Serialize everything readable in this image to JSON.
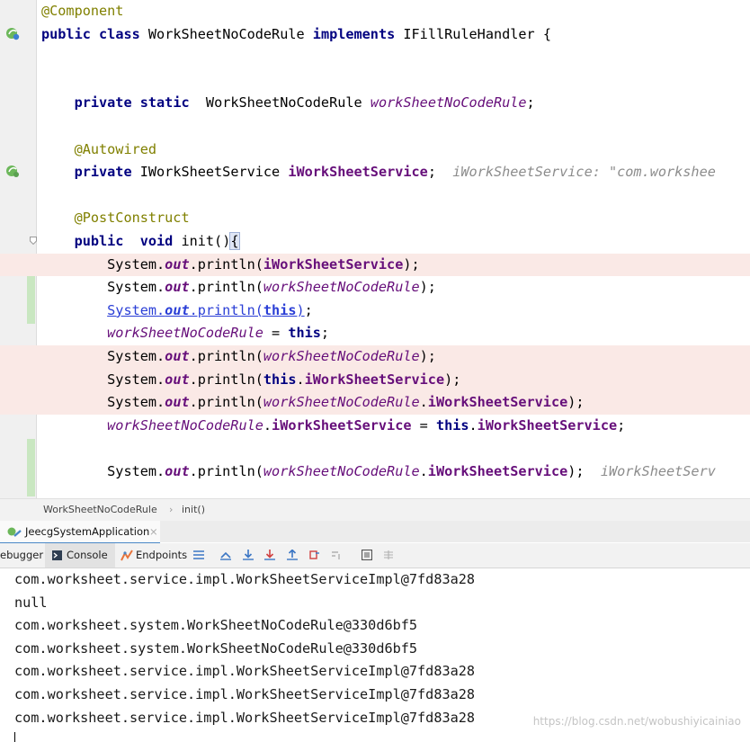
{
  "editor": {
    "lines": {
      "l0": {
        "ann": "@Component"
      },
      "l1": {
        "kw1": "public",
        "kw2": "class",
        "name": "WorkSheetNoCodeRule",
        "kw3": "implements",
        "iface": "IFillRuleHandler",
        "brace": "{"
      },
      "l4": {
        "kw1": "private",
        "kw2": "static",
        "type": "WorkSheetNoCodeRule",
        "field": "workSheetNoCodeRule",
        "semi": ";"
      },
      "l6": {
        "ann": "@Autowired"
      },
      "l7": {
        "kw1": "private",
        "type": "IWorkSheetService",
        "field": "iWorkSheetService",
        "semi": ";",
        "hint": "iWorkSheetService: \"com.workshee"
      },
      "l9": {
        "ann": "@PostConstruct"
      },
      "l10": {
        "kw1": "public",
        "kw2": "void",
        "method": "init()",
        "brace": "{"
      },
      "l11": {
        "sys": "System.",
        "out": "out",
        "call": ".println(",
        "arg": "iWorkSheetService",
        "end": ");"
      },
      "l12": {
        "sys": "System.",
        "out": "out",
        "call": ".println(",
        "arg": "workSheetNoCodeRule",
        "end": ");"
      },
      "l13": {
        "sys": "System.",
        "out": "out",
        "call": ".println(",
        "arg": "this",
        "close": ")",
        "end": ";"
      },
      "l14": {
        "field": "workSheetNoCodeRule",
        "eq": " = ",
        "kw": "this",
        "end": ";"
      },
      "l15": {
        "sys": "System.",
        "out": "out",
        "call": ".println(",
        "arg": "workSheetNoCodeRule",
        "end": ");"
      },
      "l16": {
        "sys": "System.",
        "out": "out",
        "call": ".println(",
        "kw": "this",
        "dot": ".",
        "arg": "iWorkSheetService",
        "end": ");"
      },
      "l17": {
        "sys": "System.",
        "out": "out",
        "call": ".println(",
        "arg": "workSheetNoCodeRule",
        "dot": ".",
        "arg2": "iWorkSheetService",
        "end": ");"
      },
      "l18": {
        "field": "workSheetNoCodeRule",
        "dot": ".",
        "field2": "iWorkSheetService",
        "eq": " = ",
        "kw": "this",
        "dot2": ".",
        "field3": "iWorkSheetService",
        "end": ";"
      },
      "l20": {
        "sys": "System.",
        "out": "out",
        "call": ".println(",
        "arg": "workSheetNoCodeRule",
        "dot": ".",
        "arg2": "iWorkSheetService",
        "end": ");",
        "hint": "iWorkSheetServ"
      }
    }
  },
  "breadcrumb": {
    "class": "WorkSheetNoCodeRule",
    "sep": "›",
    "method": "init()"
  },
  "run_tabs": {
    "app": "JeecgSystemApplication",
    "close": "×"
  },
  "toolbar": {
    "debugger": "ebugger",
    "console": "Console",
    "endpoints": "Endpoints"
  },
  "console": {
    "lines": [
      "com.worksheet.service.impl.WorkSheetServiceImpl@7fd83a28",
      "null",
      "com.worksheet.system.WorkSheetNoCodeRule@330d6bf5",
      "com.worksheet.system.WorkSheetNoCodeRule@330d6bf5",
      "com.worksheet.service.impl.WorkSheetServiceImpl@7fd83a28",
      "com.worksheet.service.impl.WorkSheetServiceImpl@7fd83a28",
      "com.worksheet.service.impl.WorkSheetServiceImpl@7fd83a28"
    ]
  },
  "watermark": "https://blog.csdn.net/wobushiyicainiao",
  "colors": {
    "keyword": "#000080",
    "annotation": "#808000",
    "field": "#660e7a",
    "breakpoint_bg": "#fae9e6",
    "gutter": "#f0f0f0"
  }
}
